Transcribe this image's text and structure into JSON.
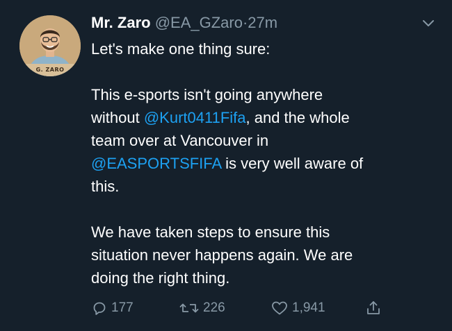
{
  "tweet": {
    "display_name": "Mr. Zaro",
    "handle": "@EA_GZaro",
    "separator": "·",
    "time": "27m",
    "avatar_label": "G. ZARO",
    "lines": {
      "l1": "Let's make one thing sure:",
      "l2": "This e-sports isn't going anywhere",
      "l3a": "without ",
      "l3_mention": "@Kurt0411Fifa",
      "l3b": ", and the whole",
      "l4": "team over at Vancouver in",
      "l5_mention": "@EASPORTSFIFA",
      "l5b": " is very well aware of",
      "l6": "this.",
      "l7": "We have taken steps to ensure this",
      "l8": "situation never happens again. We are",
      "l9": "doing the right thing."
    },
    "actions": {
      "replies": "177",
      "retweets": "226",
      "likes": "1,941"
    },
    "icons": {
      "menu": "chevron-down-icon",
      "reply": "reply-icon",
      "retweet": "retweet-icon",
      "like": "heart-icon",
      "share": "share-icon"
    },
    "colors": {
      "background": "#15202b",
      "text": "#ffffff",
      "muted": "#8899a6",
      "link": "#1da1f2"
    }
  }
}
